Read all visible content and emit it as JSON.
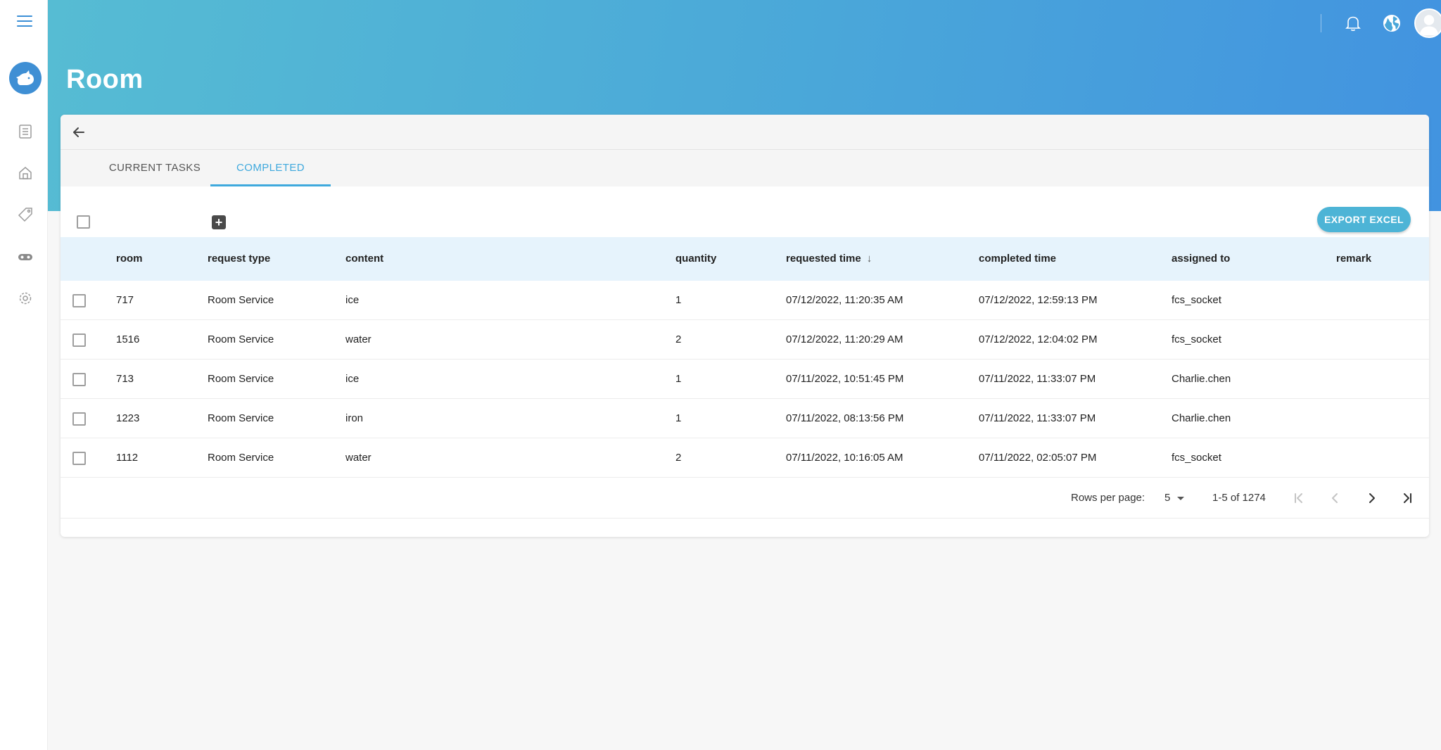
{
  "header": {
    "title": "Room"
  },
  "icons": {
    "menu": "hamburger-icon",
    "logo": "rhino-logo-icon",
    "nav": [
      "document-list-icon",
      "home-icon",
      "tag-icon",
      "gamepad-icon",
      "gear-icon"
    ],
    "bell": "bell-icon",
    "globe": "globe-icon",
    "avatar": "avatar-icon",
    "back": "back-arrow-icon"
  },
  "colors": {
    "accent": "#3fa9dd",
    "header_start": "#56bcd3",
    "header_end": "#4293e0",
    "table_header_bg": "#e6f3fc",
    "export_button": "#4db4d6"
  },
  "tabs": [
    {
      "label": "CURRENT TASKS",
      "active": false
    },
    {
      "label": "COMPLETED",
      "active": true
    }
  ],
  "toolbar": {
    "add_label": "+",
    "export_label": "EXPORT EXCEL"
  },
  "table": {
    "columns": {
      "room": "room",
      "request_type": "request type",
      "content": "content",
      "quantity": "quantity",
      "requested_time": "requested time",
      "completed_time": "completed time",
      "assigned_to": "assigned to",
      "remark": "remark"
    },
    "sort_indicator": "↓",
    "rows": [
      {
        "room": "717",
        "request_type": "Room Service",
        "content": "ice",
        "quantity": "1",
        "requested_time": "07/12/2022, 11:20:35 AM",
        "completed_time": "07/12/2022, 12:59:13 PM",
        "assigned_to": "fcs_socket",
        "remark": ""
      },
      {
        "room": "1516",
        "request_type": "Room Service",
        "content": "water",
        "quantity": "2",
        "requested_time": "07/12/2022, 11:20:29 AM",
        "completed_time": "07/12/2022, 12:04:02 PM",
        "assigned_to": "fcs_socket",
        "remark": ""
      },
      {
        "room": "713",
        "request_type": "Room Service",
        "content": "ice",
        "quantity": "1",
        "requested_time": "07/11/2022, 10:51:45 PM",
        "completed_time": "07/11/2022, 11:33:07 PM",
        "assigned_to": "Charlie.chen",
        "remark": ""
      },
      {
        "room": "1223",
        "request_type": "Room Service",
        "content": "iron",
        "quantity": "1",
        "requested_time": "07/11/2022, 08:13:56 PM",
        "completed_time": "07/11/2022, 11:33:07 PM",
        "assigned_to": "Charlie.chen",
        "remark": ""
      },
      {
        "room": "1112",
        "request_type": "Room Service",
        "content": "water",
        "quantity": "2",
        "requested_time": "07/11/2022, 10:16:05 AM",
        "completed_time": "07/11/2022, 02:05:07 PM",
        "assigned_to": "fcs_socket",
        "remark": ""
      }
    ]
  },
  "pagination": {
    "rows_per_page_label": "Rows per page:",
    "rows_per_page_value": "5",
    "range": "1-5 of 1274"
  }
}
